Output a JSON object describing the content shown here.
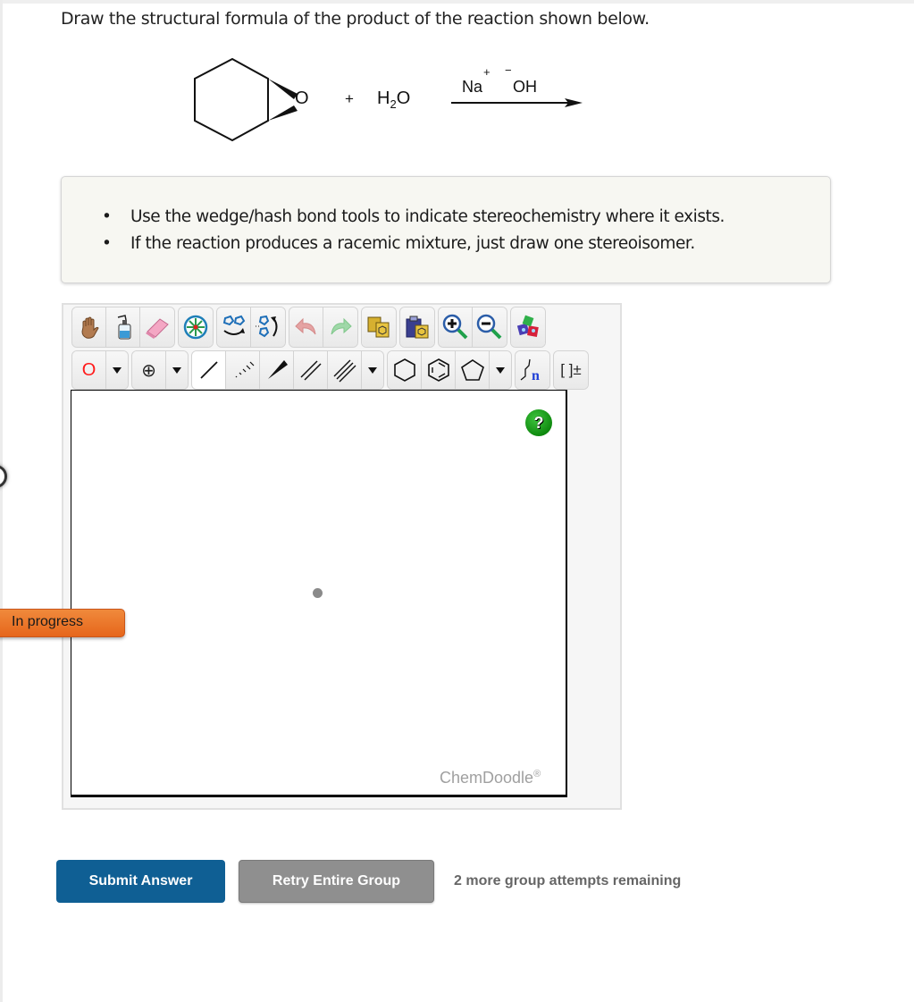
{
  "question": {
    "prompt": "Draw the structural formula of the product of the reaction shown below."
  },
  "reaction": {
    "reactant_1_atom": "O",
    "plus": "+",
    "reactant_2": "H",
    "reactant_2_sub": "2",
    "reactant_2_tail": "O",
    "reagent_cation": "Na",
    "reagent_cation_charge": "+",
    "reagent_anion": "OH",
    "reagent_anion_charge": "−"
  },
  "instructions": {
    "items": [
      "Use the wedge/hash bond tools to indicate stereochemistry where it exists.",
      "If the reaction produces a racemic mixture, just draw one stereoisomer."
    ]
  },
  "editor": {
    "toolbar_row1": [
      {
        "name": "hand-icon",
        "label": "Pan"
      },
      {
        "name": "clear-bottle-icon",
        "label": "Clear"
      },
      {
        "name": "eraser-icon",
        "label": "Erase"
      },
      {
        "name": "center-icon",
        "label": "Center"
      },
      {
        "name": "flip-horizontal-icon",
        "label": "Flip horizontal"
      },
      {
        "name": "flip-vertical-icon",
        "label": "Flip vertical"
      },
      {
        "name": "undo-icon",
        "label": "Undo"
      },
      {
        "name": "redo-icon",
        "label": "Redo"
      },
      {
        "name": "copy-icon",
        "label": "Copy"
      },
      {
        "name": "paste-icon",
        "label": "Paste"
      },
      {
        "name": "zoom-in-icon",
        "label": "Zoom in"
      },
      {
        "name": "zoom-out-icon",
        "label": "Zoom out"
      },
      {
        "name": "clean-icon",
        "label": "Clean"
      }
    ],
    "atom_selected": "O",
    "charge_symbol": "⊕",
    "polymer_label": "n",
    "bracket_label": "[ ]±",
    "help_label": "?",
    "brand": "ChemDoodle",
    "brand_mark": "®"
  },
  "status": {
    "label": "In progress"
  },
  "actions": {
    "submit_label": "Submit Answer",
    "retry_label": "Retry Entire Group",
    "attempts_text": "2 more group attempts remaining"
  },
  "colors": {
    "submit": "#0f5f94",
    "retry": "#8f8f8f",
    "status_tab": "#e6661b",
    "help": "#0f8a0f",
    "atom_O": "#ff1a1a"
  }
}
